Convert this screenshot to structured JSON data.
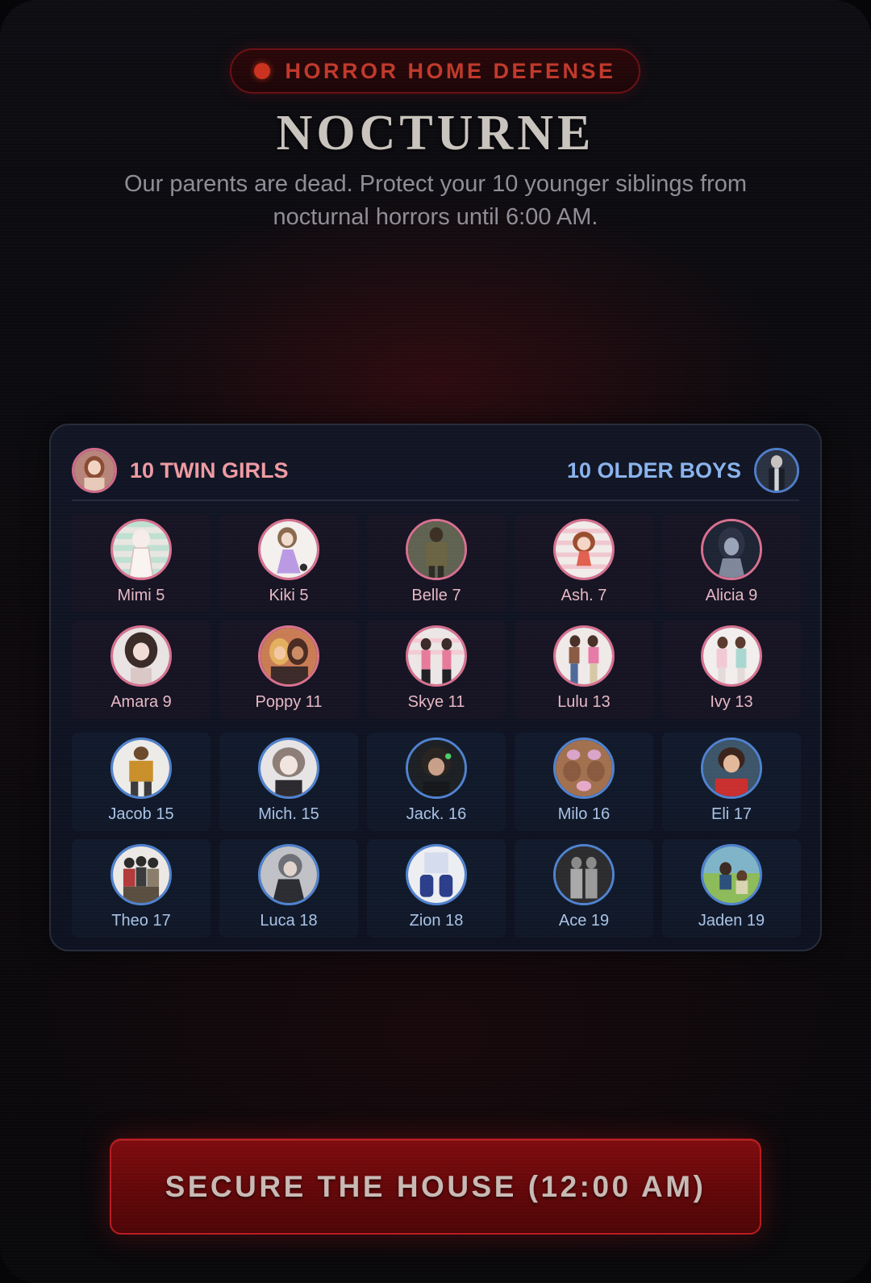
{
  "header": {
    "badge": "HORROR HOME DEFENSE",
    "title": "NOCTURNE",
    "subtitle": "Our parents are dead. Protect your 10 younger siblings from nocturnal horrors until 6:00 AM."
  },
  "roster": {
    "girls_heading": "10 TWIN GIRLS",
    "boys_heading": "10 OLDER BOYS",
    "girls": [
      {
        "label": "Mimi 5"
      },
      {
        "label": "Kiki 5"
      },
      {
        "label": "Belle 7"
      },
      {
        "label": "Ash. 7"
      },
      {
        "label": "Alicia 9"
      },
      {
        "label": "Amara 9"
      },
      {
        "label": "Poppy 11"
      },
      {
        "label": "Skye 11"
      },
      {
        "label": "Lulu 13"
      },
      {
        "label": "Ivy 13"
      }
    ],
    "boys": [
      {
        "label": "Jacob 15"
      },
      {
        "label": "Mich. 15"
      },
      {
        "label": "Jack. 16"
      },
      {
        "label": "Milo 16"
      },
      {
        "label": "Eli 17"
      },
      {
        "label": "Theo 17"
      },
      {
        "label": "Luca 18"
      },
      {
        "label": "Zion 18"
      },
      {
        "label": "Ace 19"
      },
      {
        "label": "Jaden 19"
      }
    ]
  },
  "cta": {
    "label": "SECURE THE HOUSE (12:00 AM)"
  },
  "colors": {
    "accent_red": "#c0392b",
    "girl_ring": "#d8708f",
    "boy_ring": "#4f82cf",
    "girl_heading": "#ee9aa3",
    "boy_heading": "#8ab3ec"
  }
}
